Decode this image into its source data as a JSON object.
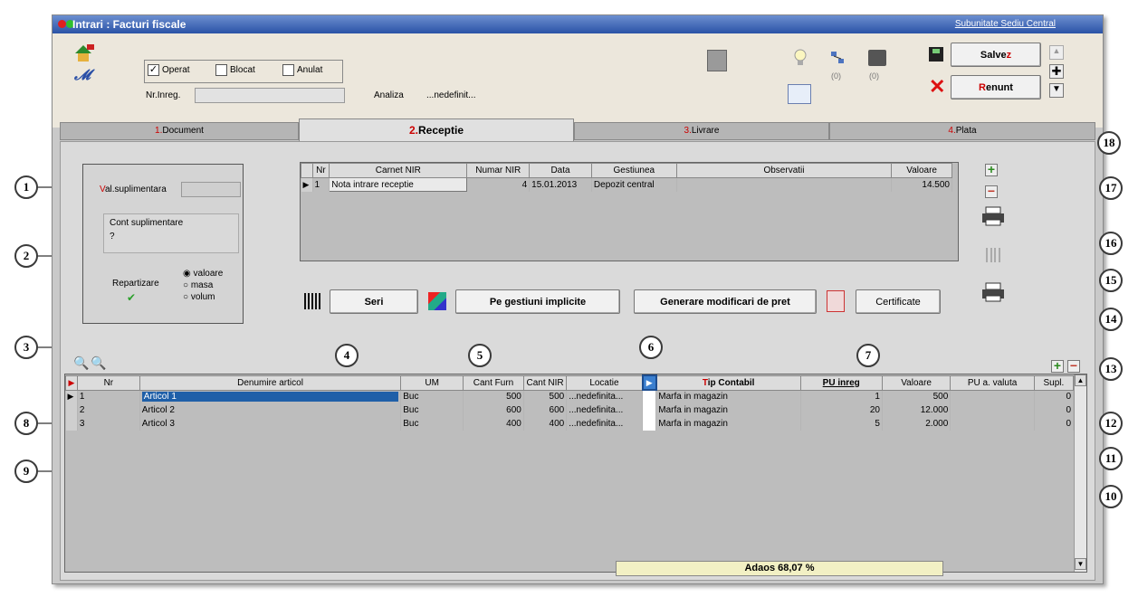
{
  "window": {
    "title": "Intrari : Facturi fiscale",
    "subunit_link": "Subunitate Sediu Central"
  },
  "header": {
    "chk_operat": "Operat",
    "chk_blocat": "Blocat",
    "chk_anulat": "Anulat",
    "nr_inreg_label": "Nr.Inreg.",
    "analiza_label": "Analiza",
    "analiza_value": "...nedefinit...",
    "count_a": "(0)",
    "count_b": "(0)",
    "save_label": "Salvez",
    "cancel_label": "Renunt",
    "save_hotkey": "z",
    "cancel_hotkey": "R"
  },
  "tabs": [
    {
      "num": "1.",
      "label": "Document"
    },
    {
      "num": "2.",
      "label": "Receptie"
    },
    {
      "num": "3.",
      "label": "Livrare"
    },
    {
      "num": "4.",
      "label": "Plata"
    }
  ],
  "left_panel": {
    "val_supl_label_first": "V",
    "val_supl_label_rest": "al.suplimentara",
    "cont_supl_label": "Cont suplimentare",
    "cont_supl_value": "?",
    "repartizare_label": "Repartizare",
    "opt_valoare": "valoare",
    "opt_masa": "masa",
    "opt_volum": "volum"
  },
  "nir_table": {
    "headers": [
      "Nr",
      "Carnet NIR",
      "Numar NIR",
      "Data",
      "Gestiunea",
      "Observatii",
      "Valoare"
    ],
    "row": {
      "nr": "1",
      "carnet": "Nota intrare receptie",
      "numar": "4",
      "data": "15.01.2013",
      "gestiunea": "Depozit central",
      "observatii": "",
      "valoare": "14.500"
    }
  },
  "buttons": {
    "seri": "Seri",
    "pe_gestiuni": "Pe gestiuni implicite",
    "generare": "Generare modificari de pret",
    "certificate": "Certificate"
  },
  "items_table": {
    "headers": {
      "nr": "Nr",
      "denumire": "Denumire articol",
      "um": "UM",
      "cant_furn": "Cant Furn",
      "cant_nir": "Cant NIR",
      "locatie": "Locatie",
      "tip_first": "T",
      "tip_rest": "ip Contabil",
      "pu_inreg": "PU inreg",
      "valoare": "Valoare",
      "pu_valuta": "PU a. valuta",
      "supl": "Supl."
    },
    "rows": [
      {
        "nr": "1",
        "denumire": "Articol 1",
        "um": "Buc",
        "cant_furn": "500",
        "cant_nir": "500",
        "locatie": "...nedefinita...",
        "tip": "Marfa in magazin",
        "pu": "1",
        "valoare": "500",
        "pu_valuta": "",
        "supl": "0"
      },
      {
        "nr": "2",
        "denumire": "Articol 2",
        "um": "Buc",
        "cant_furn": "600",
        "cant_nir": "600",
        "locatie": "...nedefinita...",
        "tip": "Marfa in magazin",
        "pu": "20",
        "valoare": "12.000",
        "pu_valuta": "",
        "supl": "0"
      },
      {
        "nr": "3",
        "denumire": "Articol 3",
        "um": "Buc",
        "cant_furn": "400",
        "cant_nir": "400",
        "locatie": "...nedefinita...",
        "tip": "Marfa in magazin",
        "pu": "5",
        "valoare": "2.000",
        "pu_valuta": "",
        "supl": "0"
      }
    ]
  },
  "footer": {
    "adaos": "Adaos 68,07 %"
  },
  "callouts": [
    "1",
    "2",
    "3",
    "4",
    "5",
    "6",
    "7",
    "8",
    "9",
    "10",
    "11",
    "12",
    "13",
    "14",
    "15",
    "16",
    "17",
    "18"
  ],
  "colors": {
    "title_bar": "#2a52a6",
    "accent_red": "#cc0000",
    "selected_cell": "#1f5fa8"
  }
}
